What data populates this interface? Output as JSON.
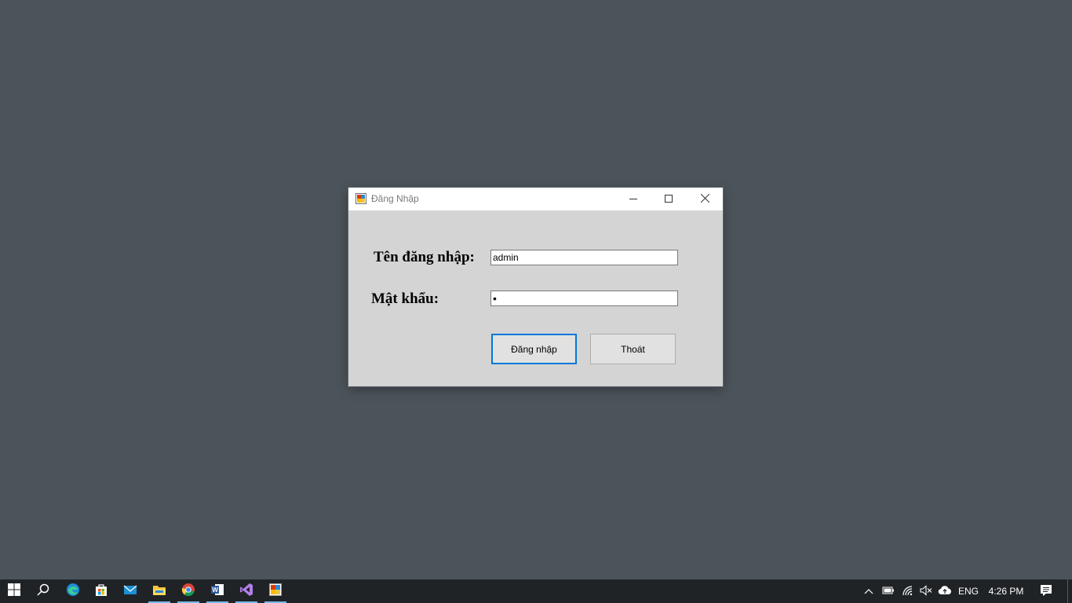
{
  "window": {
    "title": "Đăng Nhập",
    "icon": "app-form-icon",
    "controls": [
      "minimize-icon",
      "maximize-icon",
      "close-icon"
    ]
  },
  "form": {
    "username_label": "Tên đăng nhập:",
    "username_value": "admin",
    "password_label": "Mật khẩu:",
    "password_value": "•",
    "login_button": "Đăng nhập",
    "exit_button": "Thoát"
  },
  "taskbar": {
    "pinned": [
      "start-icon",
      "search-icon",
      "edge-icon",
      "store-icon",
      "mail-icon",
      "file-explorer-icon",
      "chrome-icon",
      "word-icon",
      "visual-studio-icon",
      "app-form-icon"
    ],
    "running": [
      "file-explorer-icon",
      "chrome-icon",
      "word-icon",
      "visual-studio-icon",
      "app-form-icon"
    ],
    "tray": {
      "language": "ENG",
      "time": "4:26 PM"
    }
  },
  "colors": {
    "desktop": "#4c545b",
    "dialog_bg": "#d4d4d4",
    "accent": "#0078d7",
    "taskbar": "#202326"
  }
}
